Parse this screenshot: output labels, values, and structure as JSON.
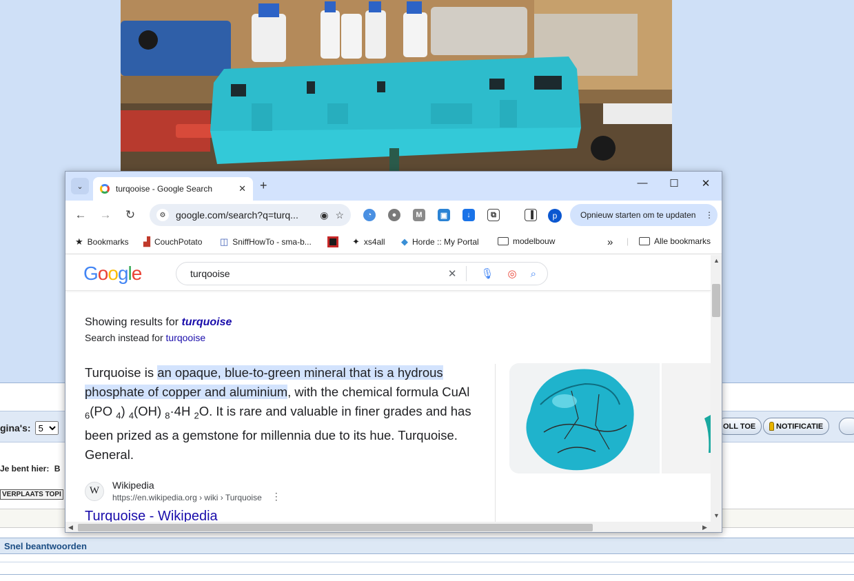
{
  "background_page": {
    "pages_label": "gina's:",
    "pages_selected": "5",
    "follow_button": "OLL TOE",
    "notification_button": "NOTIFICATIE",
    "you_are_here": "Je bent hier:",
    "you_are_here_value": "B",
    "move_topic": "VERPLAATS TOPI",
    "quick_reply": "Snel beantwoorden"
  },
  "browser": {
    "tab_title": "turqooise - Google Search",
    "tab_close": "✕",
    "new_tab": "+",
    "minimize": "—",
    "maximize": "☐",
    "close": "✕",
    "url": "google.com/search?q=turq...",
    "profile_initial": "p",
    "update_button": "Opnieuw starten om te updaten",
    "bookmarks": [
      {
        "label": "Bookmarks"
      },
      {
        "label": "CouchPotato"
      },
      {
        "label": "SniffHowTo - sma-b..."
      },
      {
        "label": "xs4all"
      },
      {
        "label": "Horde :: My Portal"
      },
      {
        "label": "modelbouw"
      }
    ],
    "more_bookmarks": "»",
    "all_bookmarks": "Alle bookmarks"
  },
  "google": {
    "logo": "Google",
    "logo_colors": [
      "#4285f4",
      "#ea4335",
      "#fbbc05",
      "#4285f4",
      "#34a853",
      "#ea4335"
    ],
    "query": "turqooise",
    "showing_prefix": "Showing results for",
    "corrected_query": "turquoise",
    "instead_prefix": "Search instead for",
    "original_query": "turqooise",
    "snippet": {
      "part1": "Turquoise is ",
      "highlight": "an opaque, blue-to-green mineral that is a hydrous phosphate of copper and aluminium",
      "part2": ", with the chemical formula CuAl ",
      "sub1": "6",
      "part3": "(PO ",
      "sub2": "4",
      "part4": ") ",
      "sub3": "4",
      "part5": "(OH) ",
      "sub4": "8",
      "part6": "·4H ",
      "sub5": "2",
      "part7": "O. It is rare and valuable in finer grades and has been prized as a gemstone for millennia due to its hue. Turquoise. General."
    },
    "source_icon": "W",
    "source_name": "Wikipedia",
    "source_url": "https://en.wikipedia.org › wiki › Turquoise",
    "result_title": "Turquoise - Wikipedia"
  }
}
